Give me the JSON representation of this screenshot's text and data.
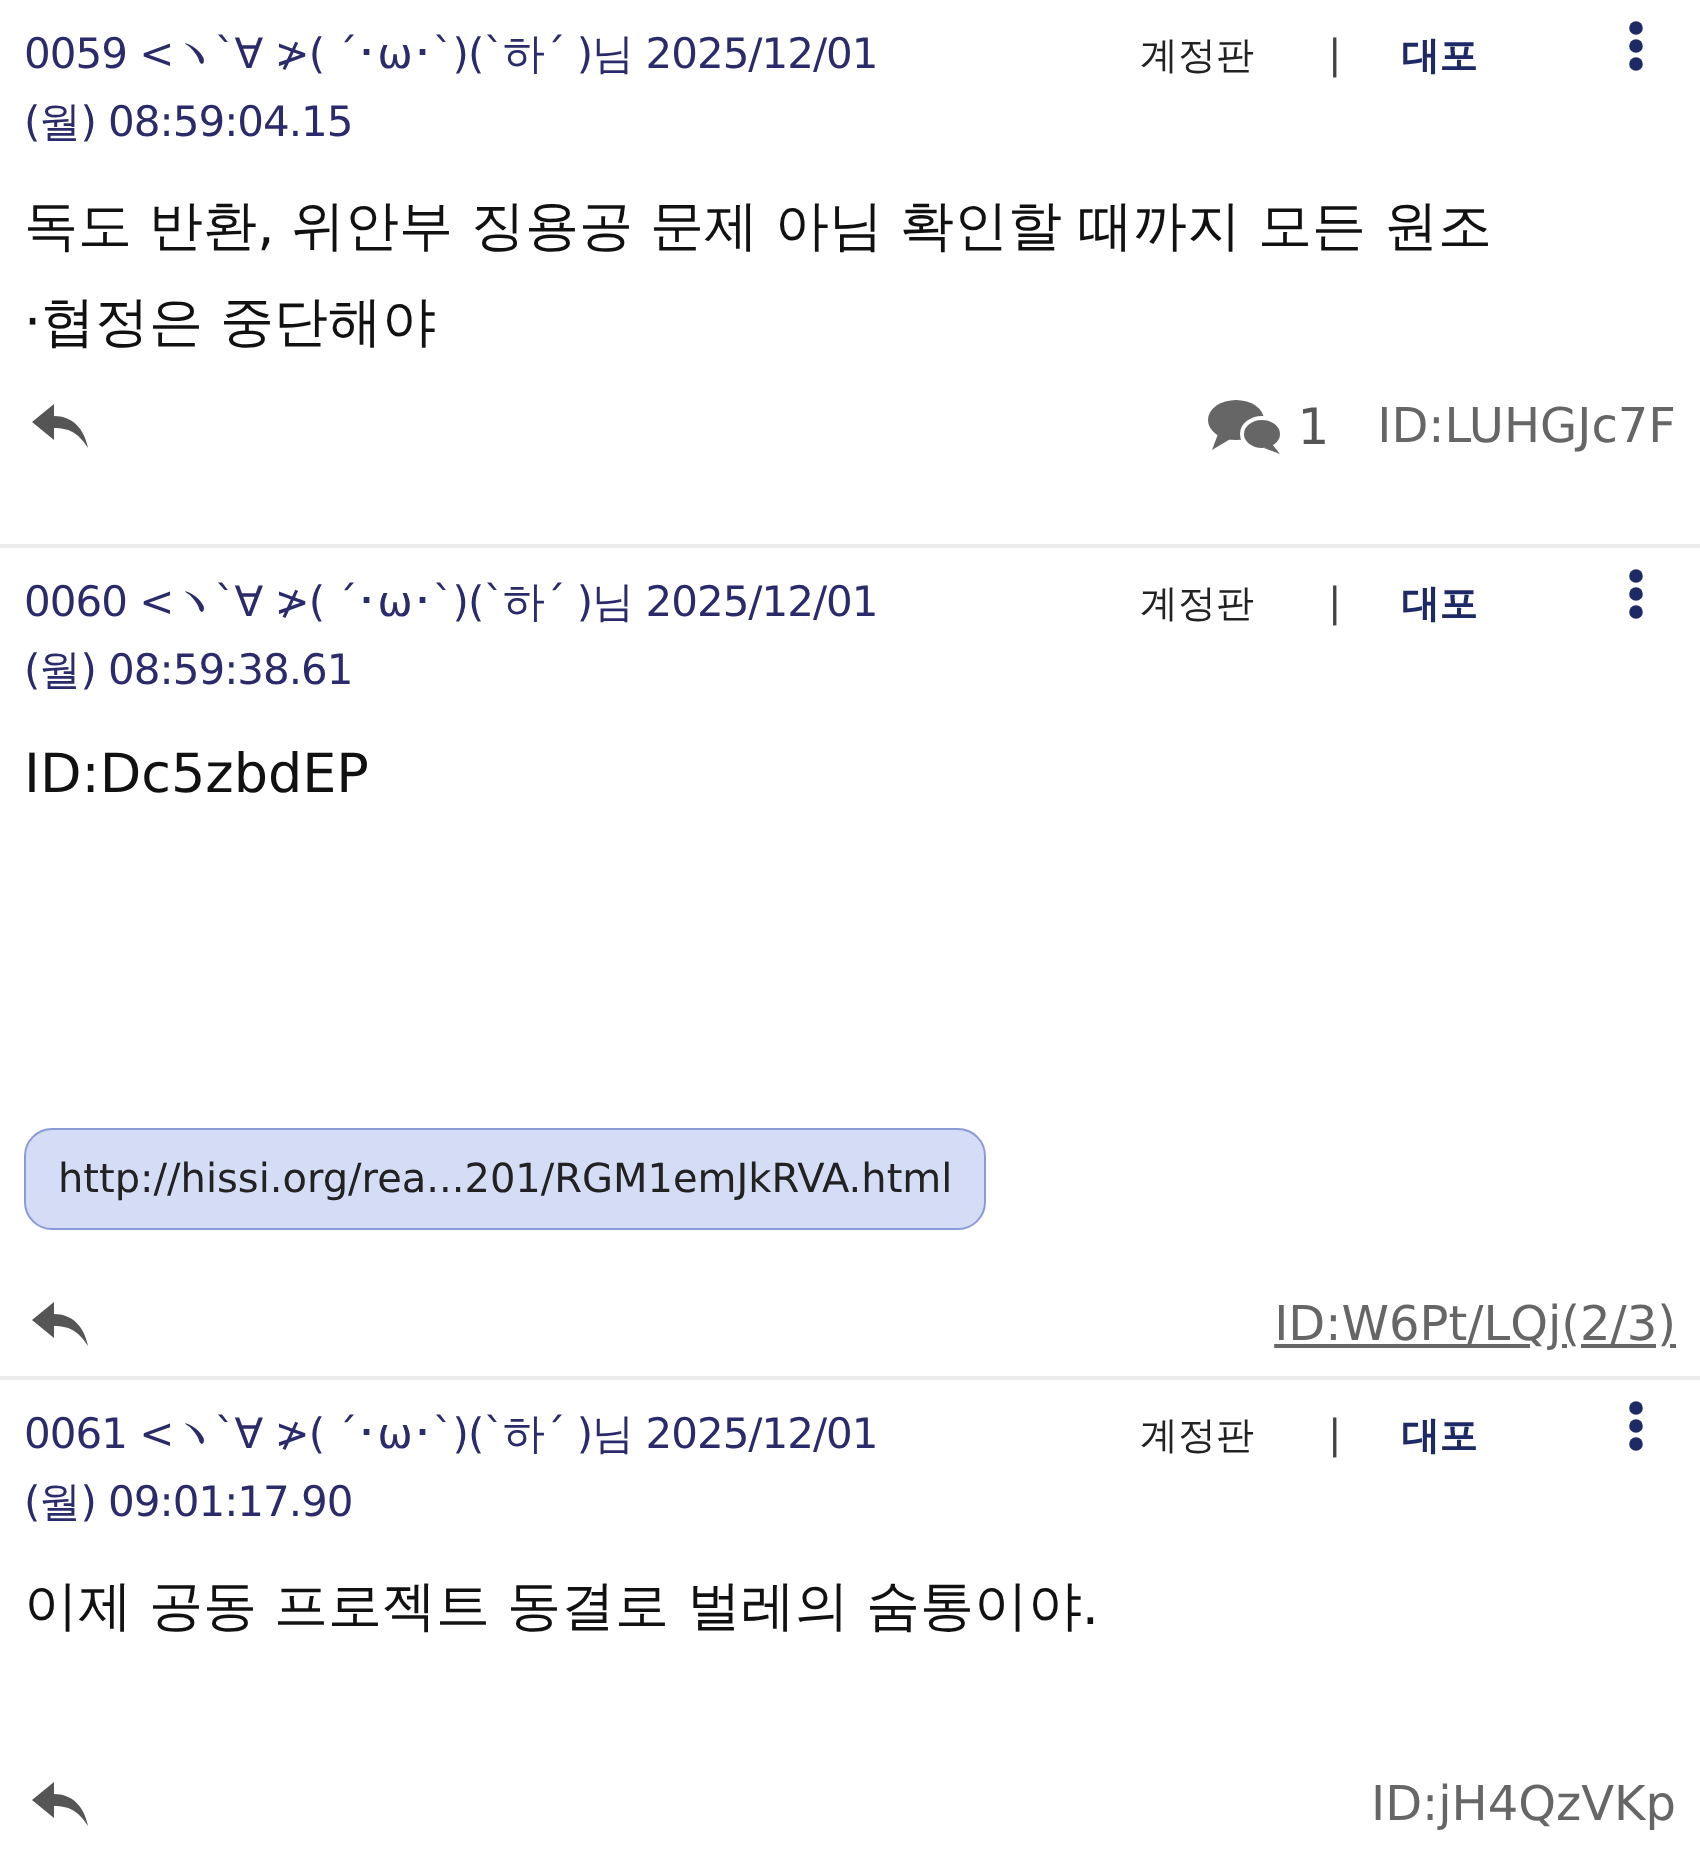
{
  "posts": [
    {
      "header": "0059 <ヽ`∀ ≯( ˊ･ω･`)(`하´ )님 2025/12/01",
      "timestamp": "(월) 08:59:04.15",
      "board": "계정판",
      "separator": "|",
      "action": "대포",
      "body": [
        "독도 반환, 위안부 징용공 문제 아님 확인할 때까지 모든 원조",
        "·협정은 중단해야"
      ],
      "comments": "1",
      "id": "ID:LUHGJc7F",
      "id_link": false
    },
    {
      "header": "0060 <ヽ`∀ ≯( ˊ･ω･`)(`하´ )님 2025/12/01",
      "timestamp": "(월) 08:59:38.61",
      "board": "계정판",
      "separator": "|",
      "action": "대포",
      "body": [
        "ID:Dc5zbdEP"
      ],
      "link": "http://hissi.org/rea...201/RGM1emJkRVA.html",
      "id": "ID:W6Pt/LQj(2/3)",
      "id_link": true
    },
    {
      "header": "0061 <ヽ`∀ ≯( ˊ･ω･`)(`하´ )님 2025/12/01",
      "timestamp": "(월) 09:01:17.90",
      "board": "계정판",
      "separator": "|",
      "action": "대포",
      "body": [
        "이제 공동 프로젝트 동결로 벌레의 숨통이야."
      ],
      "id": "ID:jH4QzVKp",
      "id_link": false
    }
  ]
}
